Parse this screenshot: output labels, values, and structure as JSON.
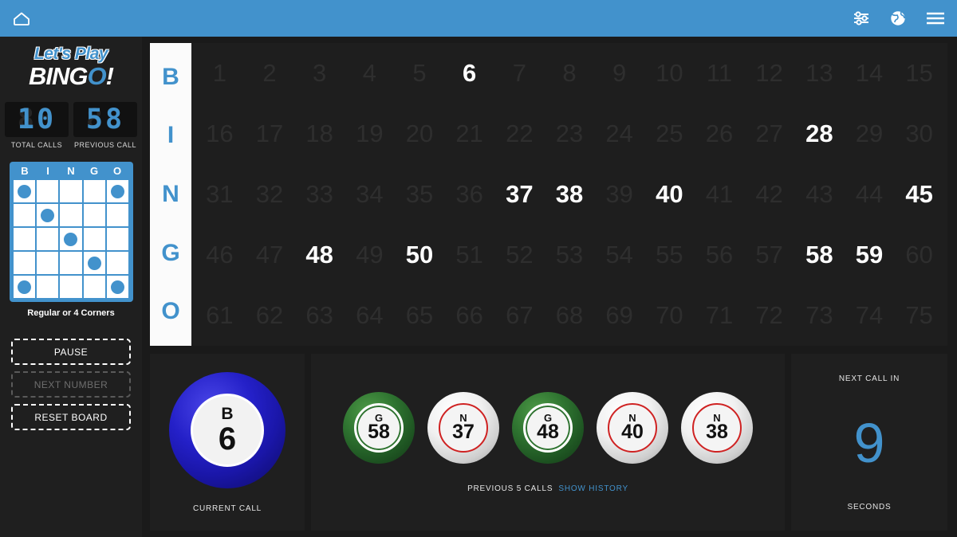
{
  "header": {
    "home_icon": "home-icon",
    "icons": [
      {
        "name": "settings-sliders-icon"
      },
      {
        "name": "globe-icon"
      },
      {
        "name": "hamburger-menu-icon"
      }
    ]
  },
  "sidebar": {
    "logo_line1": "Let's Play",
    "logo_line2_a": "BING",
    "logo_line2_o": "O",
    "logo_line2_b": "!",
    "counters": [
      {
        "name": "total-calls",
        "value": "10",
        "ghost": "88",
        "label": "TOTAL CALLS"
      },
      {
        "name": "previous-call",
        "value": "58",
        "ghost": "88",
        "label": "PREVIOUS CALL"
      }
    ],
    "pattern": {
      "headers": [
        "B",
        "I",
        "N",
        "G",
        "O"
      ],
      "marked": [
        [
          true,
          false,
          false,
          false,
          true
        ],
        [
          false,
          true,
          false,
          false,
          false
        ],
        [
          false,
          false,
          true,
          false,
          false
        ],
        [
          false,
          false,
          false,
          true,
          false
        ],
        [
          true,
          false,
          false,
          false,
          true
        ]
      ],
      "name": "Regular or 4 Corners"
    },
    "buttons": [
      {
        "name": "pause-button",
        "label": "PAUSE",
        "enabled": true
      },
      {
        "name": "next-number-button",
        "label": "NEXT NUMBER",
        "enabled": false
      },
      {
        "name": "reset-board-button",
        "label": "RESET BOARD",
        "enabled": true
      }
    ]
  },
  "board": {
    "letters": [
      "B",
      "I",
      "N",
      "G",
      "O"
    ],
    "rows": [
      {
        "letter": "B",
        "numbers": [
          1,
          2,
          3,
          4,
          5,
          6,
          7,
          8,
          9,
          10,
          11,
          12,
          13,
          14,
          15
        ]
      },
      {
        "letter": "I",
        "numbers": [
          16,
          17,
          18,
          19,
          20,
          21,
          22,
          23,
          24,
          25,
          26,
          27,
          28,
          29,
          30
        ]
      },
      {
        "letter": "N",
        "numbers": [
          31,
          32,
          33,
          34,
          35,
          36,
          37,
          38,
          39,
          40,
          41,
          42,
          43,
          44,
          45
        ]
      },
      {
        "letter": "G",
        "numbers": [
          46,
          47,
          48,
          49,
          50,
          51,
          52,
          53,
          54,
          55,
          56,
          57,
          58,
          59,
          60
        ]
      },
      {
        "letter": "O",
        "numbers": [
          61,
          62,
          63,
          64,
          65,
          66,
          67,
          68,
          69,
          70,
          71,
          72,
          73,
          74,
          75
        ]
      }
    ],
    "called": [
      6,
      28,
      37,
      38,
      40,
      45,
      48,
      50,
      58,
      59
    ]
  },
  "current_call": {
    "letter": "B",
    "number": "6",
    "color": "#2420c8",
    "caption": "CURRENT CALL"
  },
  "previous_calls": {
    "caption": "PREVIOUS 5 CALLS",
    "history_link": "SHOW HISTORY",
    "balls": [
      {
        "letter": "G",
        "number": "58",
        "style": "green"
      },
      {
        "letter": "N",
        "number": "37",
        "style": "white"
      },
      {
        "letter": "G",
        "number": "48",
        "style": "green"
      },
      {
        "letter": "N",
        "number": "40",
        "style": "white"
      },
      {
        "letter": "N",
        "number": "38",
        "style": "white"
      }
    ]
  },
  "next_call": {
    "title": "NEXT CALL IN",
    "seconds": "9",
    "unit": "SECONDS"
  },
  "colors": {
    "accent": "#4292cc",
    "background": "#1a1a1a",
    "panel": "#1f1f1f"
  }
}
